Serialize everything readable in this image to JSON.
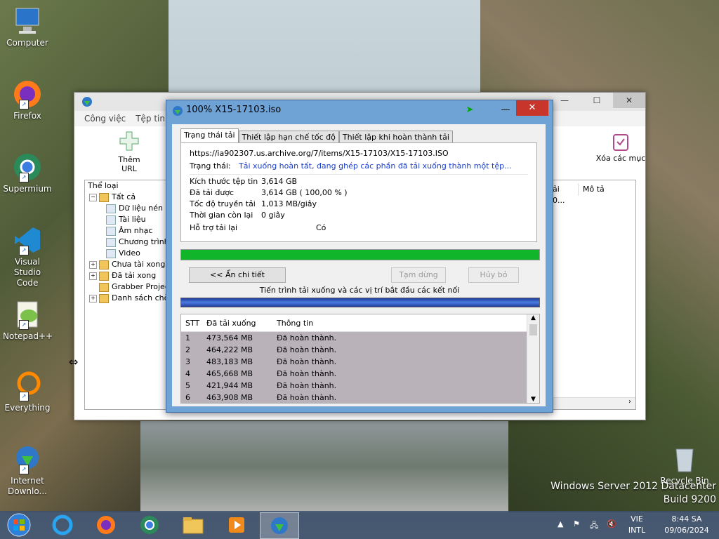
{
  "desktop": {
    "icons": [
      {
        "label": "Computer"
      },
      {
        "label": "Firefox"
      },
      {
        "label": "Supermium"
      },
      {
        "label": "Visual Studio Code"
      },
      {
        "label": "Notepad++"
      },
      {
        "label": "Everything"
      },
      {
        "label": "Internet Downlo..."
      },
      {
        "label": "Recycle Bin"
      }
    ],
    "watermark": {
      "line1": "Windows Server 2012 Datacenter",
      "line2": "Build 9200"
    }
  },
  "main_window": {
    "menu": [
      "Công việc",
      "Tệp tin"
    ],
    "toolbar": {
      "add_url": "Thêm URL",
      "delete": "Xóa các mục"
    },
    "tree_header": "Thể loại",
    "tree": [
      {
        "label": "Tất cả",
        "level": 0,
        "exp": "−"
      },
      {
        "label": "Dữ liệu nén",
        "level": 1
      },
      {
        "label": "Tài liệu",
        "level": 1
      },
      {
        "label": "Âm nhạc",
        "level": 1
      },
      {
        "label": "Chương trình",
        "level": 1
      },
      {
        "label": "Video",
        "level": 1
      },
      {
        "label": "Chưa tài xong",
        "level": 0,
        "exp": "+"
      },
      {
        "label": "Đã tải xong",
        "level": 0,
        "exp": "+"
      },
      {
        "label": "Grabber Projects",
        "level": 0,
        "exp": ""
      },
      {
        "label": "Danh sách chờ",
        "level": 0,
        "exp": "+"
      }
    ],
    "list_headers": {
      "col_a": "ải",
      "col_b": "Mô tả"
    },
    "list_row": "0..."
  },
  "dialog": {
    "title": "100% X15-17103.iso",
    "tabs": [
      "Trạng thái tải",
      "Thiết lập hạn chế tốc độ",
      "Thiết lập khi hoàn thành tải"
    ],
    "url": "https://ia902307.us.archive.org/7/items/X15-17103/X15-17103.ISO",
    "status_label": "Trạng thái:",
    "status_value": "Tải xuống hoàn tất, đang ghép các phần đã tải xuống thành một tệp...",
    "info": [
      {
        "label": "Kích thước tệp tin",
        "value": "3,614  GB"
      },
      {
        "label": "Đã tải được",
        "value": "3,614  GB  ( 100,00 % )"
      },
      {
        "label": "Tốc độ truyền tải",
        "value": "1,013  MB/giây"
      },
      {
        "label": "Thời gian còn lại",
        "value": "0 giây"
      },
      {
        "label": "Hỗ trợ tải lại",
        "value": "Có"
      }
    ],
    "progress": 1.0,
    "buttons": {
      "hide_details": "<< Ẩn chi tiết",
      "pause": "Tạm dừng",
      "cancel": "Hủy bỏ"
    },
    "connections_caption": "Tiến trình tải xuống và các vị trí bắt đầu các kết nối",
    "table": {
      "headers": [
        "STT",
        "Đã tải xuống",
        "Thông tin"
      ],
      "rows": [
        [
          "1",
          "473,564  MB",
          "Đã hoàn thành."
        ],
        [
          "2",
          "464,222  MB",
          "Đã hoàn thành."
        ],
        [
          "3",
          "483,183  MB",
          "Đã hoàn thành."
        ],
        [
          "4",
          "465,668  MB",
          "Đã hoàn thành."
        ],
        [
          "5",
          "421,944  MB",
          "Đã hoàn thành."
        ],
        [
          "6",
          "463,908  MB",
          "Đã hoàn thành."
        ]
      ]
    }
  },
  "taskbar": {
    "lang": "VIE",
    "layout": "INTL",
    "time": "8:44 SA",
    "date": "09/06/2024"
  },
  "colors": {
    "progress": "#10b52a",
    "close": "#c7352b",
    "link_blue": "#1a3fc9"
  }
}
